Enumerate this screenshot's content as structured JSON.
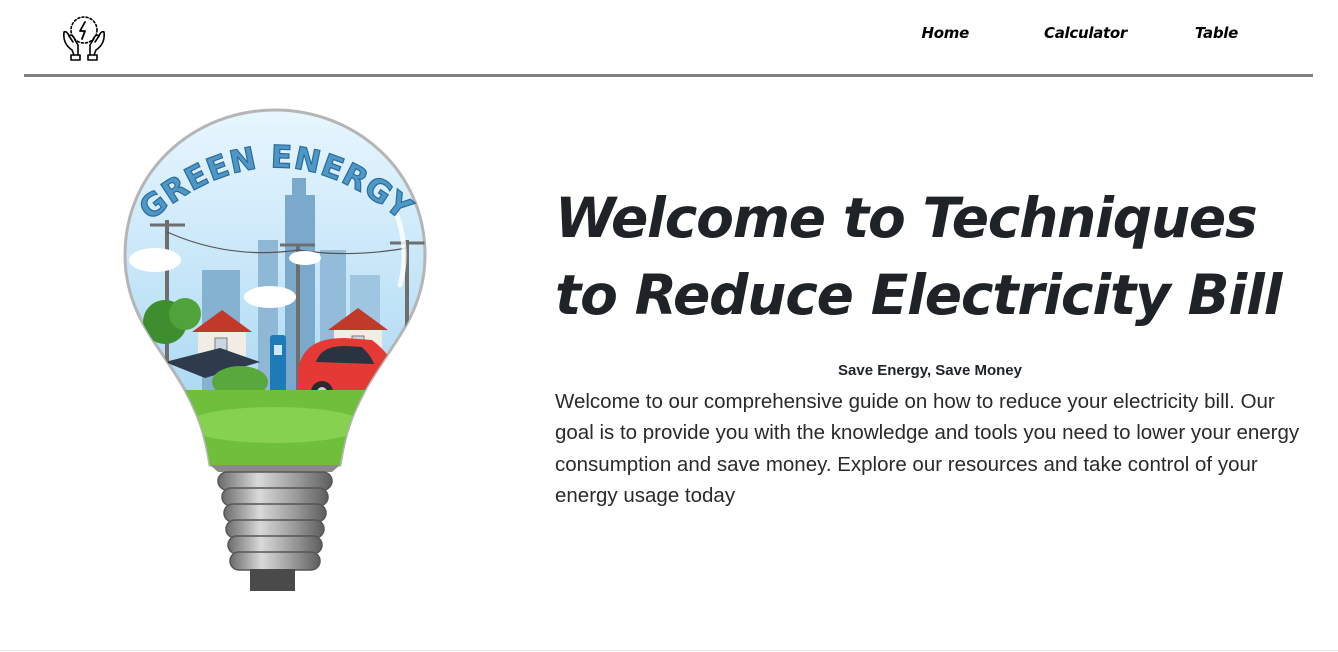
{
  "header": {
    "logo_icon": "hands-energy-icon",
    "nav": [
      {
        "label": "Home"
      },
      {
        "label": "Calculator"
      },
      {
        "label": "Table"
      }
    ]
  },
  "hero": {
    "image_icon": "green-energy-bulb-illustration",
    "image_text": "GREEN ENERGY",
    "title": "Welcome to Techniques to Reduce Electricity Bill",
    "tagline": "Save Energy, Save Money",
    "intro": "Welcome to our comprehensive guide on how to reduce your electricity bill. Our goal is to provide you with the knowledge and tools you need to lower your energy consumption and save money. Explore our resources and take control of your energy usage today"
  },
  "colors": {
    "text_dark": "#1f2328",
    "divider": "#808080",
    "sky": "#bfe3f7",
    "grass": "#6fbf3b",
    "car": "#e53935"
  }
}
